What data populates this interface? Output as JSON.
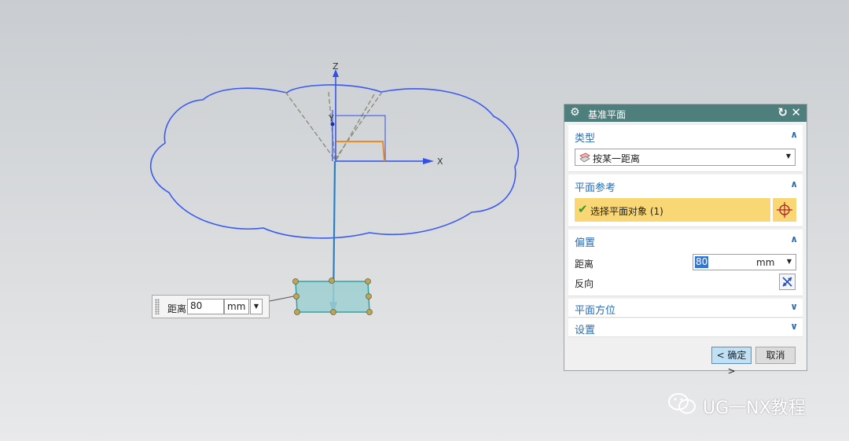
{
  "viewport": {
    "axes": {
      "x": "X",
      "y": "Y",
      "z": "Z"
    }
  },
  "float_input": {
    "label": "距离",
    "value": "80",
    "unit": "mm"
  },
  "dialog": {
    "title": "基准平面",
    "type_section": {
      "header": "类型",
      "selected": "按某一距离"
    },
    "plane_ref_section": {
      "header": "平面参考",
      "select_label": "选择平面对象 (1)"
    },
    "offset_section": {
      "header": "偏置",
      "distance_label": "距离",
      "distance_value": "80",
      "distance_unit": "mm",
      "reverse_label": "反向"
    },
    "orientation_section": {
      "header": "平面方位"
    },
    "settings_section": {
      "header": "设置"
    },
    "ok_label": "< 确定 >",
    "cancel_label": "取消"
  },
  "watermark": {
    "text": "UG一NX教程"
  },
  "colors": {
    "titlebar": "#4f7f7c",
    "section_header": "#2a6db2",
    "selection_highlight": "#f8d774",
    "curve": "#3a5af0"
  }
}
